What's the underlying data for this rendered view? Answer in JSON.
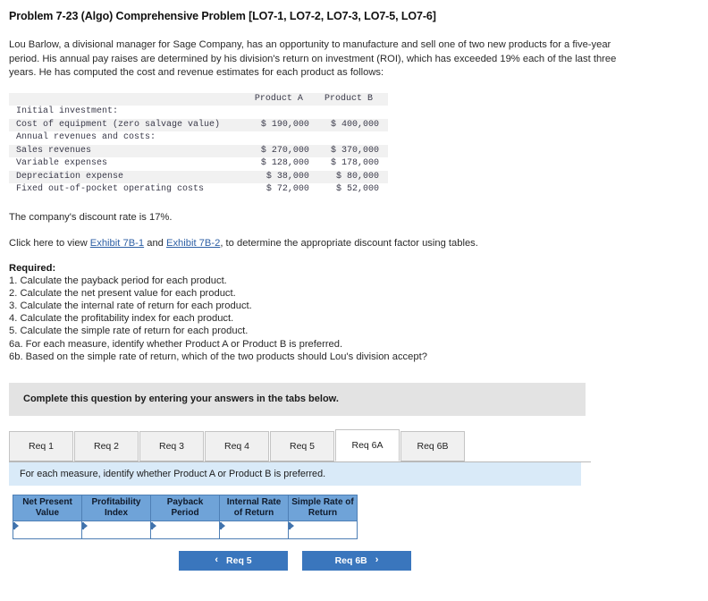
{
  "problem": {
    "title": "Problem 7-23 (Algo) Comprehensive Problem [LO7-1, LO7-2, LO7-3, LO7-5, LO7-6]",
    "intro": "Lou Barlow, a divisional manager for Sage Company, has an opportunity to manufacture and sell one of two new products for a five-year period. His annual pay raises are determined by his division's return on investment (ROI), which has exceeded 19% each of the last three years. He has computed the cost and revenue estimates for each product as follows:",
    "discount_rate_text": "The company's discount rate is 17%.",
    "exhibit_sentence": {
      "prefix": "Click here to view ",
      "link1": "Exhibit 7B-1",
      "middle": " and ",
      "link2": "Exhibit 7B-2",
      "suffix": ", to determine the appropriate discount factor using tables."
    }
  },
  "estimates_table": {
    "columns": [
      "",
      "Product A",
      "Product B"
    ],
    "rows": [
      {
        "label": "Initial investment:",
        "a": "",
        "b": "",
        "section": true
      },
      {
        "label": "Cost of equipment (zero salvage value)",
        "a": "$ 190,000",
        "b": "$ 400,000",
        "section": false
      },
      {
        "label": "Annual revenues and costs:",
        "a": "",
        "b": "",
        "section": true
      },
      {
        "label": "Sales revenues",
        "a": "$ 270,000",
        "b": "$ 370,000",
        "section": false
      },
      {
        "label": "Variable expenses",
        "a": "$ 128,000",
        "b": "$ 178,000",
        "section": false
      },
      {
        "label": "Depreciation expense",
        "a": "$ 38,000",
        "b": "$ 80,000",
        "section": false
      },
      {
        "label": "Fixed out-of-pocket operating costs",
        "a": "$ 72,000",
        "b": "$ 52,000",
        "section": false
      }
    ]
  },
  "required": {
    "heading": "Required:",
    "items": [
      "1. Calculate the payback period for each product.",
      "2. Calculate the net present value for each product.",
      "3. Calculate the internal rate of return for each product.",
      "4. Calculate the profitability index for each product.",
      "5. Calculate the simple rate of return for each product.",
      "6a. For each measure, identify whether Product A or Product B is preferred.",
      "6b. Based on the simple rate of return, which of the two products should Lou's division accept?"
    ]
  },
  "instruction_banner": "Complete this question by entering your answers in the tabs below.",
  "tabs": [
    {
      "label": "Req 1",
      "active": false
    },
    {
      "label": "Req 2",
      "active": false
    },
    {
      "label": "Req 3",
      "active": false
    },
    {
      "label": "Req 4",
      "active": false
    },
    {
      "label": "Req 5",
      "active": false
    },
    {
      "label": "Req 6A",
      "active": true
    },
    {
      "label": "Req 6B",
      "active": false
    }
  ],
  "info_strip": "For each measure, identify whether Product A or Product B is preferred.",
  "answer_table": {
    "headers": [
      "Net Present Value",
      "Profitability Index",
      "Payback Period",
      "Internal Rate of Return",
      "Simple Rate of Return"
    ],
    "values": [
      "",
      "",
      "",
      "",
      ""
    ]
  },
  "navigation": {
    "prev_label": "Req 5",
    "next_label": "Req 6B",
    "prev_chevron": "‹",
    "next_chevron": "›"
  },
  "colors": {
    "accent_blue": "#3a76bd",
    "header_blue": "#6fa3d8",
    "info_blue": "#d9eaf8",
    "banner_gray": "#e3e3e3",
    "link_blue": "#2d5fa4"
  }
}
